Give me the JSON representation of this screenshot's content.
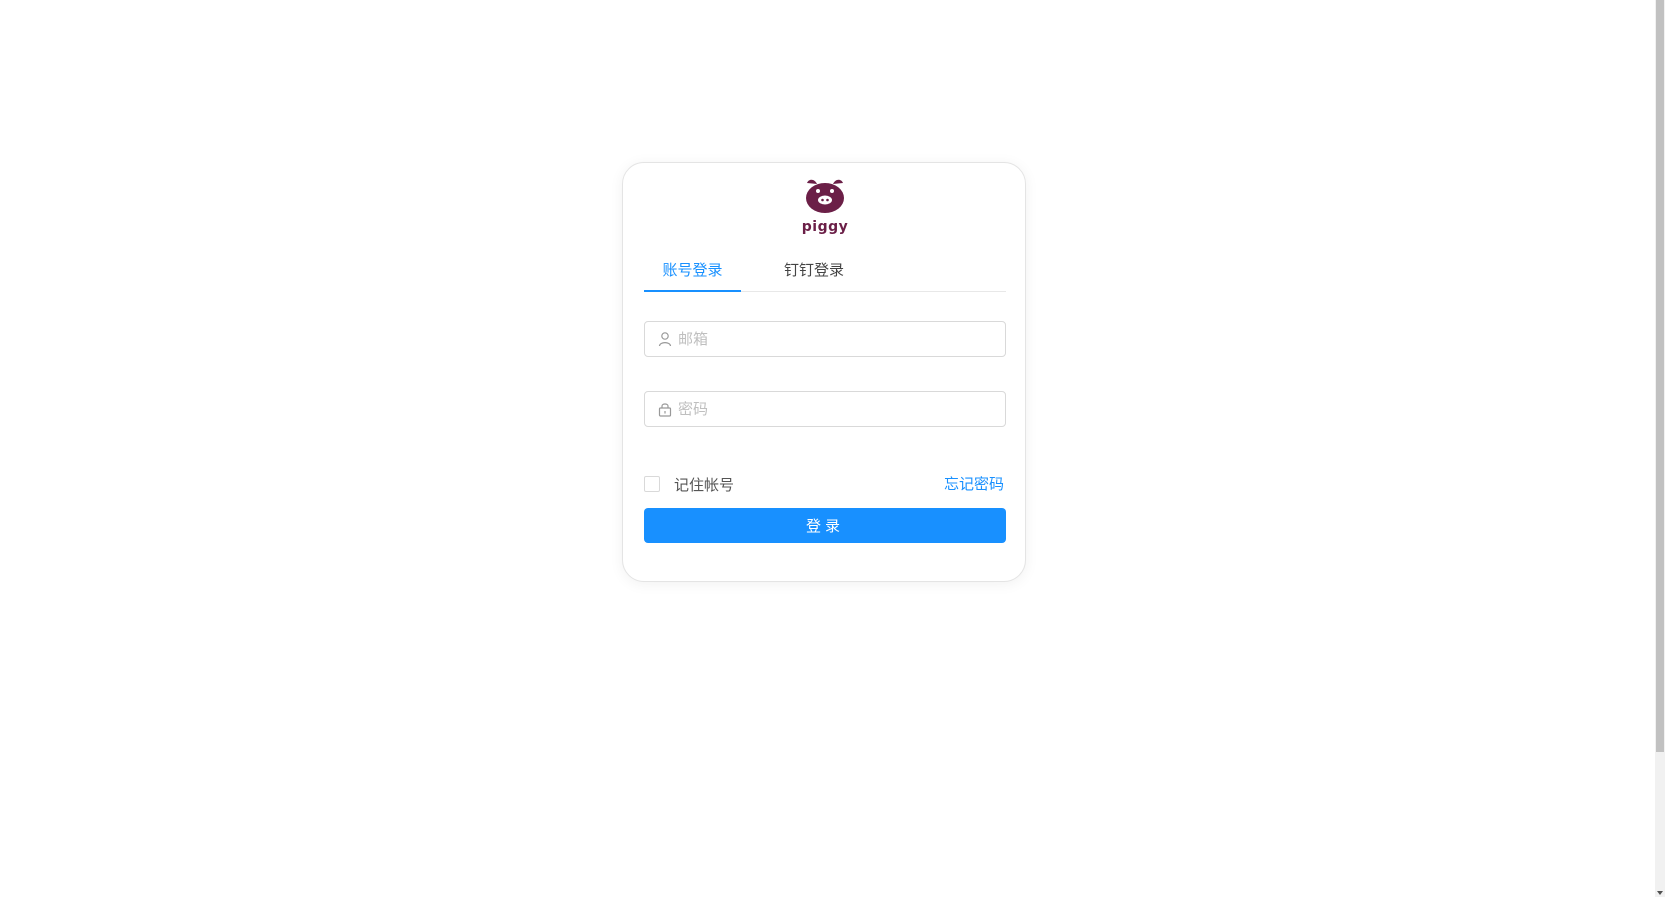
{
  "brand": {
    "name": "piggy",
    "logo_icon": "pig-face-icon",
    "color": "#6b1f47"
  },
  "tabs": [
    {
      "label": "账号登录",
      "active": true
    },
    {
      "label": "钉钉登录",
      "active": false
    }
  ],
  "form": {
    "email": {
      "placeholder": "邮箱",
      "value": "",
      "icon": "user-icon"
    },
    "password": {
      "placeholder": "密码",
      "value": "",
      "icon": "lock-icon"
    },
    "remember_label": "记住帐号",
    "remember_checked": false,
    "forgot_label": "忘记密码",
    "submit_label": "登录"
  },
  "colors": {
    "accent": "#1890ff",
    "border": "#d9d9d9",
    "placeholder": "#bfbfbf"
  }
}
